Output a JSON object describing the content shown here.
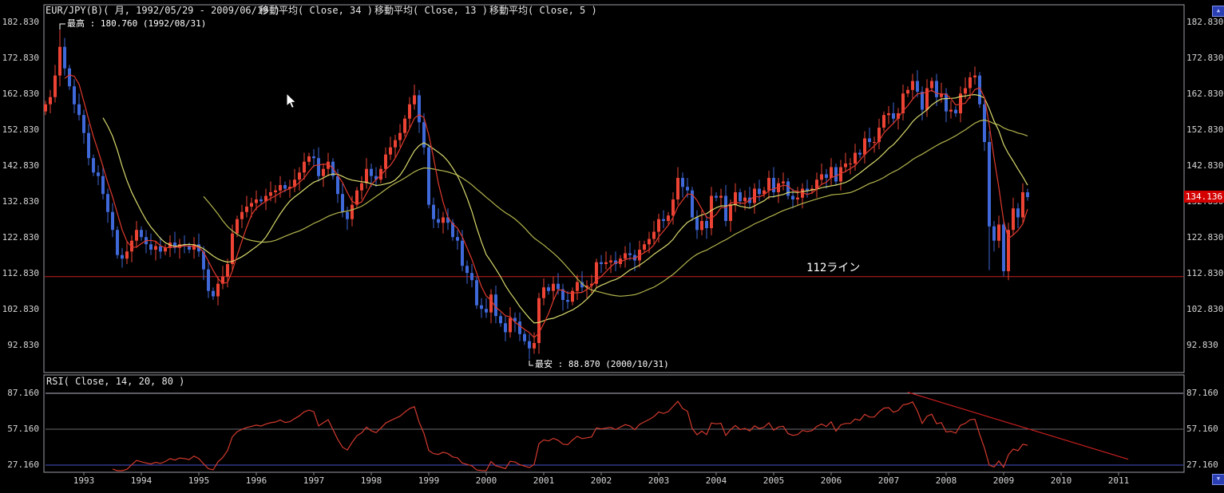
{
  "header": {
    "symbol_info": "EUR/JPY(B)( 月, 1992/05/29 - 2009/06/19 )",
    "ma_labels": [
      "移動平均( Close, 34 )",
      "移動平均( Close, 13 )",
      "移動平均( Close, 5 )"
    ]
  },
  "rsi_header": "RSI( Close, 14, 20, 80 )",
  "annotations": {
    "high": "最高 : 180.760 (1992/08/31)",
    "low": "最安 : 88.870 (2000/10/31)",
    "hline_label": "112ライン"
  },
  "price_axis": {
    "left_labels": [
      "182.830",
      "172.830",
      "162.830",
      "152.830",
      "142.830",
      "132.830",
      "122.830",
      "112.830",
      "102.830",
      "92.830"
    ],
    "right_labels": [
      "182.830",
      "172.830",
      "162.830",
      "152.830",
      "142.830",
      "132.830",
      "122.830",
      "112.830",
      "102.830",
      "92.830"
    ],
    "current": "134.136"
  },
  "rsi_axis": {
    "labels": [
      "87.160",
      "57.160",
      "27.160"
    ]
  },
  "x_axis": {
    "years": [
      "1993",
      "1994",
      "1995",
      "1996",
      "1997",
      "1998",
      "1999",
      "2000",
      "2001",
      "2002",
      "2003",
      "2004",
      "2005",
      "2006",
      "2007",
      "2008",
      "2009",
      "2010",
      "2011"
    ]
  },
  "scroll": {
    "up": "▲",
    "down": "▼"
  },
  "chart_data": {
    "type": "candlestick",
    "title": "EUR/JPY(B) monthly 1992/05/29 - 2009/06/19 with MA(34,13,5) and RSI(14)",
    "start_month": "1992-05",
    "end_month": "2009-06",
    "ylim_price": [
      85.3,
      187.7
    ],
    "first_open": 158.0,
    "closes": [
      160.0,
      162.0,
      168.0,
      176.0,
      170.0,
      165.0,
      160.0,
      157.0,
      152.0,
      145.0,
      141.0,
      140.0,
      135.0,
      130.0,
      125.0,
      118.0,
      117.0,
      119.0,
      122.0,
      125.0,
      123.0,
      121.0,
      119.5,
      120.5,
      119.0,
      120.0,
      121.5,
      120.0,
      121.0,
      120.5,
      119.5,
      121.0,
      119.0,
      114.0,
      108.0,
      106.5,
      110.0,
      112.0,
      115.5,
      124.0,
      128.0,
      130.0,
      131.5,
      132.5,
      133.5,
      133.0,
      134.5,
      135.5,
      136.0,
      137.5,
      136.5,
      137.0,
      139.0,
      141.0,
      144.0,
      145.5,
      145.0,
      140.0,
      142.0,
      144.0,
      140.0,
      135.0,
      130.0,
      128.0,
      132.0,
      136.0,
      138.0,
      142.0,
      140.0,
      139.0,
      142.0,
      146.0,
      148.0,
      150.0,
      152.0,
      156.0,
      160.0,
      162.5,
      155.0,
      148.0,
      132.0,
      128.0,
      127.0,
      128.5,
      127.0,
      123.0,
      122.0,
      115.0,
      113.0,
      111.0,
      104.0,
      103.0,
      102.0,
      107.0,
      101.0,
      99.0,
      96.5,
      100.5,
      99.5,
      96.0,
      94.0,
      92.0,
      93.5,
      106.0,
      109.0,
      108.0,
      110.0,
      108.5,
      105.5,
      105.0,
      108.0,
      110.5,
      109.0,
      109.5,
      110.0,
      116.0,
      115.5,
      116.0,
      116.5,
      115.5,
      117.0,
      118.5,
      118.0,
      116.5,
      119.5,
      121.0,
      122.5,
      124.5,
      128.0,
      127.5,
      129.0,
      133.5,
      139.5,
      137.0,
      136.0,
      128.5,
      125.0,
      127.5,
      125.5,
      134.5,
      134.0,
      134.5,
      127.5,
      132.0,
      135.5,
      133.0,
      134.0,
      132.5,
      136.5,
      135.0,
      136.0,
      139.5,
      135.5,
      138.0,
      138.5,
      134.5,
      133.5,
      134.0,
      136.5,
      136.0,
      136.5,
      139.0,
      140.5,
      139.5,
      142.5,
      138.5,
      142.5,
      143.5,
      143.5,
      146.5,
      146.0,
      150.5,
      149.5,
      149.5,
      153.5,
      157.0,
      157.5,
      156.0,
      157.5,
      163.0,
      164.0,
      166.5,
      163.5,
      158.5,
      164.5,
      166.5,
      162.0,
      163.0,
      158.0,
      158.5,
      157.5,
      163.0,
      164.5,
      167.5,
      168.0,
      160.0,
      149.5,
      126.0,
      122.0,
      126.5,
      113.5,
      125.0,
      131.0,
      128.5,
      135.5,
      134.136
    ],
    "wick_overrides": {
      "3": {
        "high": 180.76
      },
      "101": {
        "low": 88.87
      },
      "197": {
        "low": 113.8
      },
      "200": {
        "low": 112.1
      }
    },
    "extremes": {
      "high": {
        "date": "1992/08/31",
        "value": 180.76
      },
      "low": {
        "date": "2000/10/31",
        "value": 88.87
      }
    },
    "price_ticks": [
      182.83,
      172.83,
      162.83,
      152.83,
      142.83,
      132.83,
      122.83,
      112.83,
      102.83,
      92.83
    ],
    "current_price": 134.136,
    "moving_averages": [
      {
        "period": 34,
        "color": "#b4b54e"
      },
      {
        "period": 13,
        "color": "#d9da6d"
      },
      {
        "period": 5,
        "color": "#e03a2e"
      }
    ],
    "hline": {
      "price": 112.0,
      "color": "#c61f1f"
    },
    "rsi": {
      "period": 14,
      "color": "#d23a2e",
      "ticks": [
        87.16,
        57.16,
        27.16
      ],
      "levels": [
        {
          "value": 87.16,
          "color": "#b9b9cb"
        },
        {
          "value": 57.16,
          "color": "#6c6c75"
        },
        {
          "value": 27.16,
          "color": "#4a52c8"
        }
      ],
      "trendline": {
        "from_month_index": 180,
        "from_value": 88.0,
        "to_month_index": 226,
        "to_value": 32.0,
        "color": "#c61f1f"
      }
    },
    "colors": {
      "up": "#ec4334",
      "down": "#3f68d8",
      "pane_border": "#9d9da6",
      "background": "#000000"
    }
  }
}
